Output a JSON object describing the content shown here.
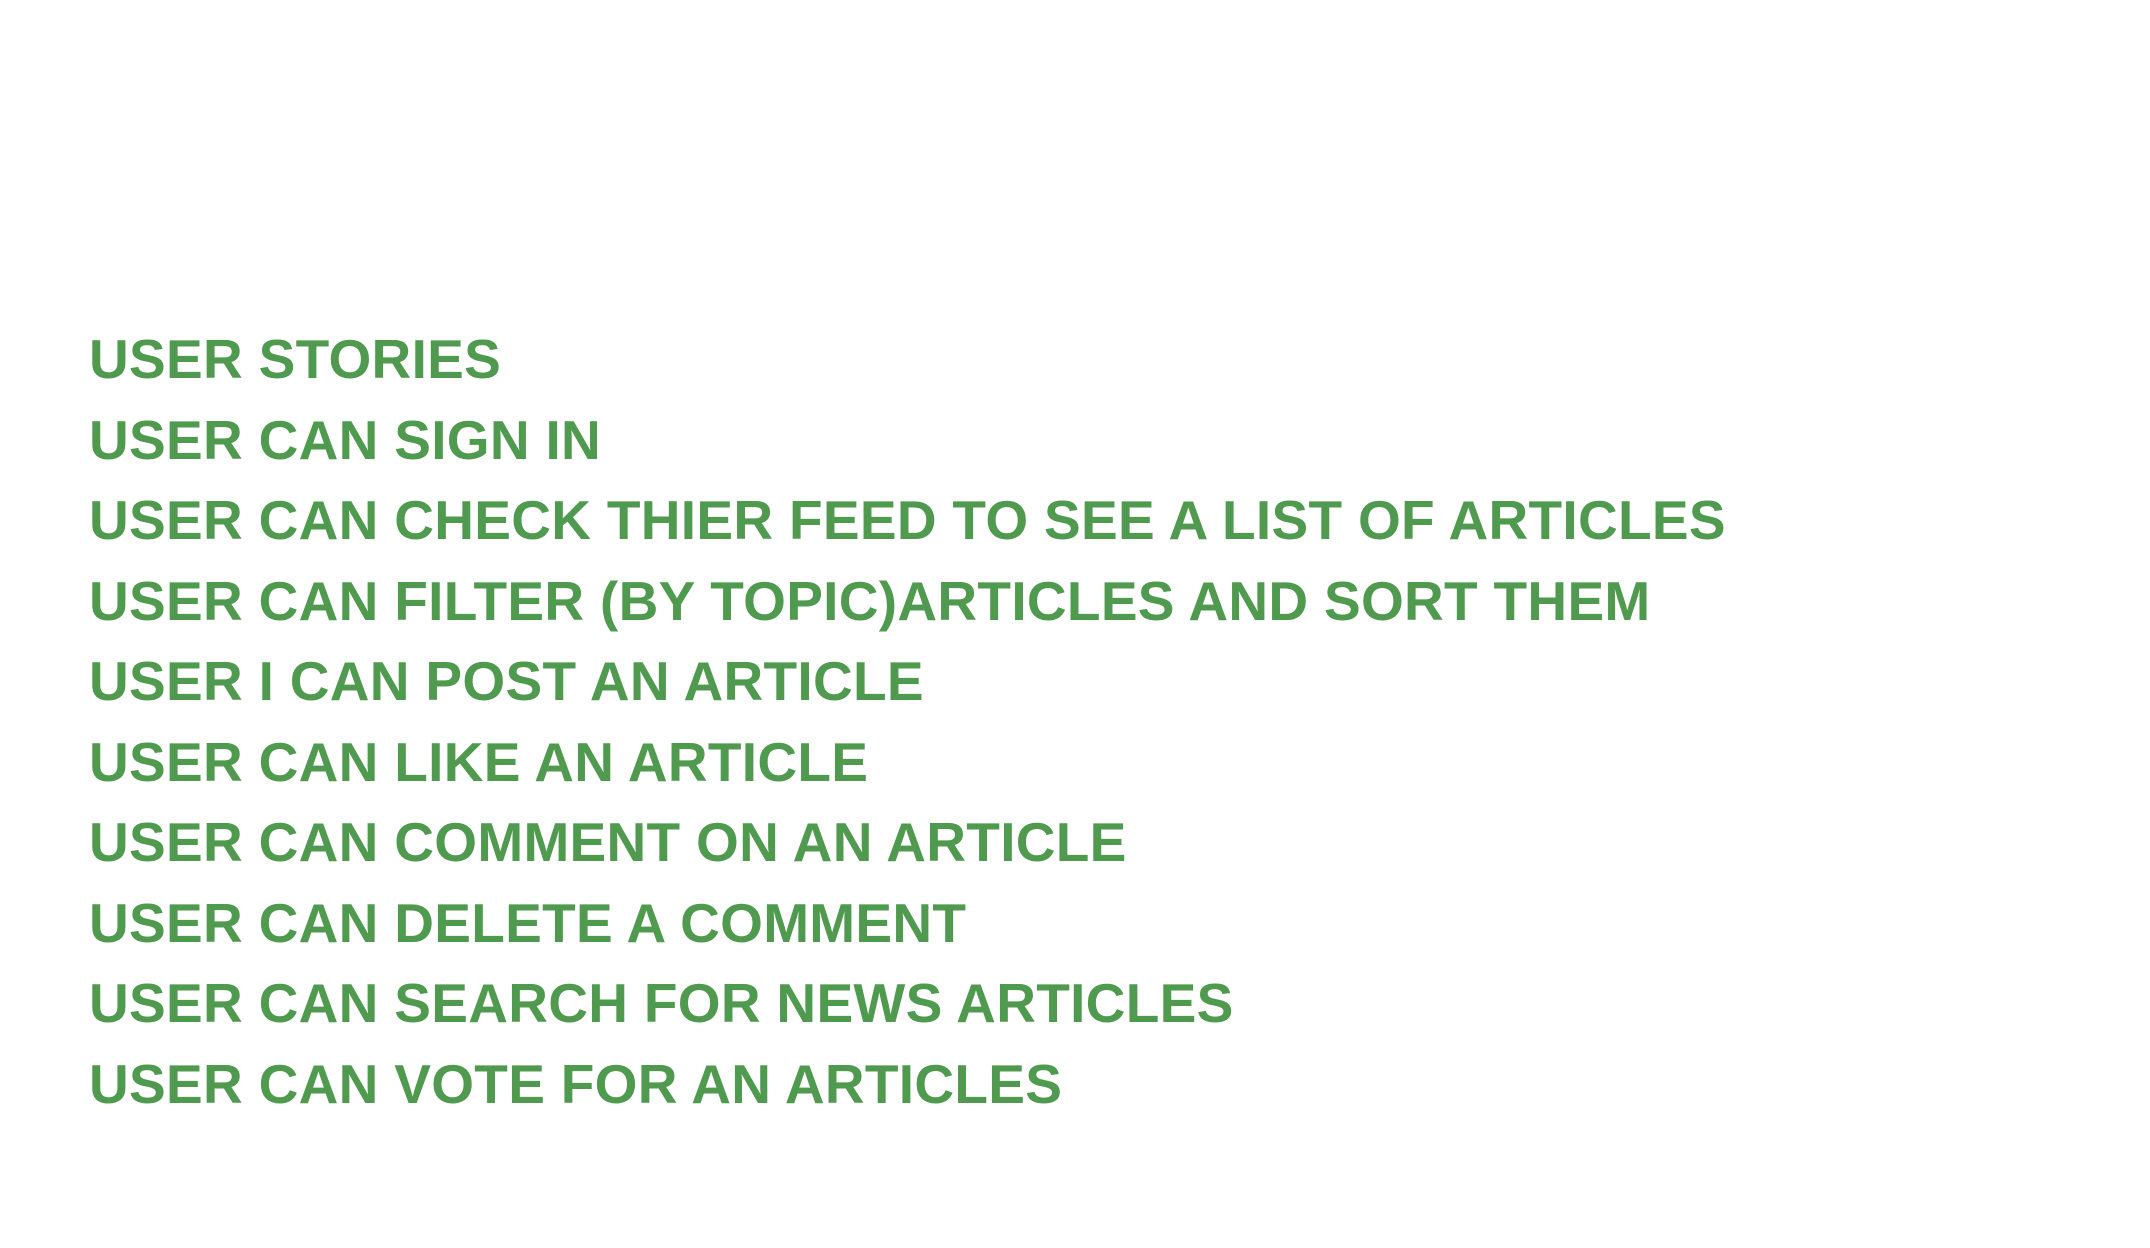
{
  "theme": {
    "text_color": "#4f9a4f",
    "background": "#ffffff"
  },
  "stories": {
    "heading": "USER STORIES",
    "items": [
      "USER CAN SIGN IN",
      "USER CAN CHECK THIER FEED TO SEE A LIST OF ARTICLES",
      "USER CAN FILTER (BY TOPIC)ARTICLES AND SORT THEM",
      "USER I CAN POST AN ARTICLE",
      "USER CAN LIKE AN ARTICLE",
      "USER CAN COMMENT ON AN ARTICLE",
      "USER CAN DELETE A COMMENT",
      "USER CAN SEARCH FOR NEWS ARTICLES",
      "USER CAN VOTE FOR AN ARTICLES"
    ]
  }
}
